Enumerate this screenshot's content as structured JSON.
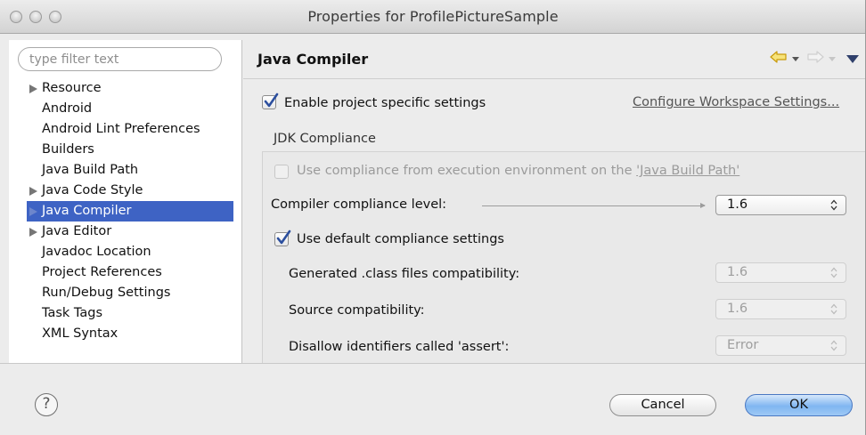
{
  "window": {
    "title": "Properties for ProfilePictureSample"
  },
  "sidebar": {
    "filter_placeholder": "type filter text",
    "items": [
      {
        "label": "Resource",
        "expandable": true,
        "selected": false
      },
      {
        "label": "Android",
        "expandable": false,
        "selected": false
      },
      {
        "label": "Android Lint Preferences",
        "expandable": false,
        "selected": false
      },
      {
        "label": "Builders",
        "expandable": false,
        "selected": false
      },
      {
        "label": "Java Build Path",
        "expandable": false,
        "selected": false
      },
      {
        "label": "Java Code Style",
        "expandable": true,
        "selected": false
      },
      {
        "label": "Java Compiler",
        "expandable": true,
        "selected": true
      },
      {
        "label": "Java Editor",
        "expandable": true,
        "selected": false
      },
      {
        "label": "Javadoc Location",
        "expandable": false,
        "selected": false
      },
      {
        "label": "Project References",
        "expandable": false,
        "selected": false
      },
      {
        "label": "Run/Debug Settings",
        "expandable": false,
        "selected": false
      },
      {
        "label": "Task Tags",
        "expandable": false,
        "selected": false
      },
      {
        "label": "XML Syntax",
        "expandable": false,
        "selected": false
      }
    ]
  },
  "main": {
    "title": "Java Compiler",
    "enable_specific": {
      "label": "Enable project specific settings",
      "checked": true
    },
    "configure_link": "Configure Workspace Settings...",
    "jdk_group_title": "JDK Compliance",
    "use_exec_env": {
      "label": "Use compliance from execution environment on the ",
      "link": "'Java Build Path'",
      "checked": false,
      "enabled": false
    },
    "compliance_level": {
      "label": "Compiler compliance level:",
      "value": "1.6"
    },
    "use_default": {
      "label": "Use default compliance settings",
      "checked": true
    },
    "generated_class": {
      "label": "Generated .class files compatibility:",
      "value": "1.6",
      "enabled": false
    },
    "source_compat": {
      "label": "Source compatibility:",
      "value": "1.6",
      "enabled": false
    },
    "disallow_assert": {
      "label": "Disallow identifiers called 'assert':",
      "value": "Error",
      "enabled": false
    }
  },
  "footer": {
    "help_glyph": "?",
    "cancel_label": "Cancel",
    "ok_label": "OK"
  },
  "colors": {
    "selection": "#3e63c4",
    "check": "#2c4f9e",
    "nav_back": "#e8b417",
    "ok_button": "#80b6f1"
  },
  "icons": {
    "back": "back-arrow-icon",
    "forward": "forward-arrow-icon",
    "menu": "view-menu-icon",
    "help": "help-icon"
  }
}
